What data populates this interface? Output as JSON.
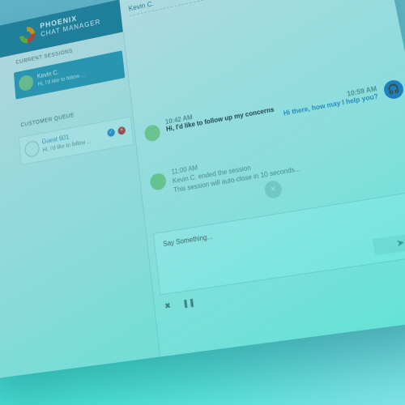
{
  "app": {
    "brand_line1": "PHOENIX",
    "brand_line2": "CHAT MANAGER"
  },
  "sidebar": {
    "current_sessions_title": "CURRENT SESSIONS",
    "current_session": {
      "name": "Kevin C.",
      "snippet": "Hi, I'd like to follow ..."
    },
    "queue_title": "CUSTOMER QUEUE",
    "queue_item": {
      "name": "Guest 601",
      "snippet": "Hi, I'd like to follow ..."
    }
  },
  "chat": {
    "header": "Kevin C.",
    "messages": [
      {
        "time": "10:42 AM",
        "text": "Hi, I'd like to follow up my concerns"
      },
      {
        "time": "10:59 AM",
        "text": "Hi there, how may I help you?"
      },
      {
        "time": "11:00 AM",
        "line1": "Kevin C. ended the session",
        "line2": "This session will auto-close in 10 seconds..."
      }
    ],
    "composer_placeholder": "Say Something...",
    "send_icon": "send-icon",
    "controls": {
      "close_icon": "close-icon",
      "pause_icon": "pause-icon"
    }
  },
  "colors": {
    "accent": "#2a8fa8",
    "agent_text": "#3a9fd0",
    "tint": "#44ddd5"
  }
}
